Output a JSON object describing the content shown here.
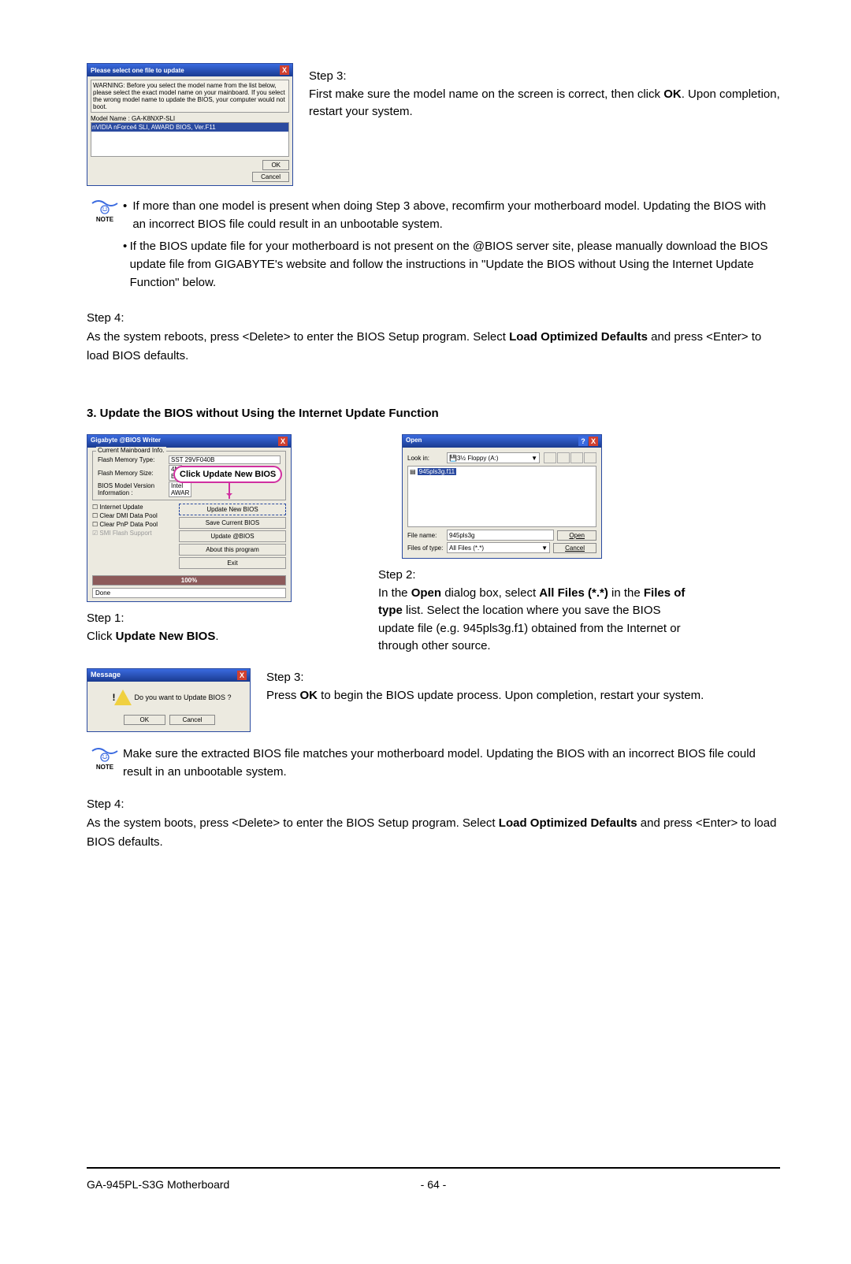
{
  "dlg1": {
    "title": "Please select one file to update",
    "warning": "WARNING: Before you select the model name from the list below, please select the exact model name on your mainboard. If you select the wrong model name to update the BIOS, your computer would not boot.",
    "model_label": "Model Name : GA-K8NXP-SLI",
    "selected": "nVIDIA nForce4 SLI, AWARD BIOS, Ver.F11",
    "ok": "OK",
    "cancel": "Cancel"
  },
  "step3a": {
    "label": "Step 3:",
    "text1": "First make sure the model name on the screen is correct, then click ",
    "ok": "OK",
    "text2": ". Upon completion, restart your system."
  },
  "note1": {
    "label": "NOTE",
    "item1": "If more than one model is present when doing Step 3 above, recomfirm your motherboard model. Updating the BIOS with an incorrect BIOS file could result in an unbootable system.",
    "item2": "If the BIOS update file for your motherboard is not present on the @BIOS server site, please manually download the BIOS update file from GIGABYTE's website and follow the instructions in \"Update the BIOS without Using the Internet Update Function\" below."
  },
  "step4a": {
    "label": "Step 4:",
    "t1": "As the system reboots, press <Delete> to enter the BIOS Setup program. Select ",
    "b1": "Load Optimized Defaults",
    "t2": " and press <Enter> to load BIOS defaults."
  },
  "heading3": "3.   Update the BIOS without Using the Internet Update Function",
  "biosw": {
    "title": "Gigabyte @BIOS Writer",
    "group": "Current Mainboard Info.",
    "r1l": "Flash Memory Type:",
    "r1v": "SST 29VF040B",
    "r2l": "Flash Memory Size:",
    "r2v": "4M B",
    "r3l": "BIOS Model Version Information :",
    "r3v": "Intel AWAR",
    "callout_pre": "Click ",
    "callout_bold": "Update New BIOS",
    "chk1": "Internet Update",
    "chk2": "Clear DMI Data Pool",
    "chk3": "Clear PnP Data Pool",
    "chk4": "SMI Flash Support",
    "btn1": "Update New BIOS",
    "btn2": "Save Current BIOS",
    "btn3": "Update @BIOS",
    "btn4": "About this program",
    "btn5": "Exit",
    "progress": "100%",
    "done": "Done"
  },
  "step1": {
    "label": "Step 1:",
    "t1": "Click ",
    "b1": "Update New BIOS",
    "t2": "."
  },
  "opendlg": {
    "title": "Open",
    "lookin": "Look in:",
    "lookin_val": "3½ Floppy (A:)",
    "file_sel": "945pls3g.f11",
    "filename_l": "File name:",
    "filename_v": "945pls3g",
    "filetype_l": "Files of type:",
    "filetype_v": "All Files (*.*)",
    "open": "Open",
    "cancel": "Cancel"
  },
  "step2": {
    "label": "Step 2:",
    "t1": "In the ",
    "b1": "Open",
    "t2": " dialog box, select  ",
    "b2": "All Files (*.*)",
    "t3": " in the ",
    "b3": "Files of type",
    "t4": " list. Select the location where you save the BIOS update file (e.g. 945pls3g.f1) obtained from the Internet or through other source."
  },
  "msgdlg": {
    "title": "Message",
    "text": "Do you want to Update BIOS ?",
    "ok": "OK",
    "cancel": "Cancel"
  },
  "step3b": {
    "label": "Step 3:",
    "t1": "Press ",
    "b1": "OK",
    "t2": " to begin the BIOS update process. Upon completion, restart your system."
  },
  "note2": {
    "label": "NOTE",
    "text": "Make sure the extracted BIOS file matches your motherboard model. Updating the BIOS with an incorrect BIOS file could result in an unbootable system."
  },
  "step4b": {
    "label": "Step 4:",
    "t1": "As the system boots, press <Delete> to enter the BIOS Setup program. Select ",
    "b1": "Load Optimized Defaults",
    "t2": " and press <Enter> to load BIOS defaults."
  },
  "footer": {
    "left": "GA-945PL-S3G Motherboard",
    "page": "- 64 -"
  }
}
